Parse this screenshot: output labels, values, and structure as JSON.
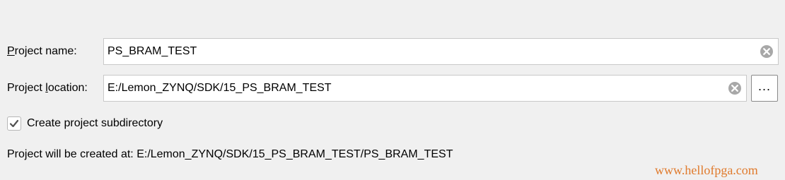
{
  "form": {
    "project_name": {
      "label_mnemonic": "P",
      "label_rest": "roject name:",
      "value": "PS_BRAM_TEST",
      "clear_icon": "clear-circle-icon"
    },
    "project_location": {
      "label_pre": "Project ",
      "label_mnemonic": "l",
      "label_rest": "ocation:",
      "value": "E:/Lemon_ZYNQ/SDK/15_PS_BRAM_TEST",
      "clear_icon": "clear-circle-icon",
      "browse_label": "..."
    },
    "create_subdirectory": {
      "label": "Create project subdirectory",
      "checked": true
    },
    "summary": "Project will be created at: E:/Lemon_ZYNQ/SDK/15_PS_BRAM_TEST/PS_BRAM_TEST"
  },
  "watermark": {
    "text": "www.hellofpga.com",
    "color": "#e07a2c"
  },
  "colors": {
    "background": "#f0f0f0",
    "field_border": "#c9c9c9",
    "clear_icon": "#a8a8a8"
  }
}
